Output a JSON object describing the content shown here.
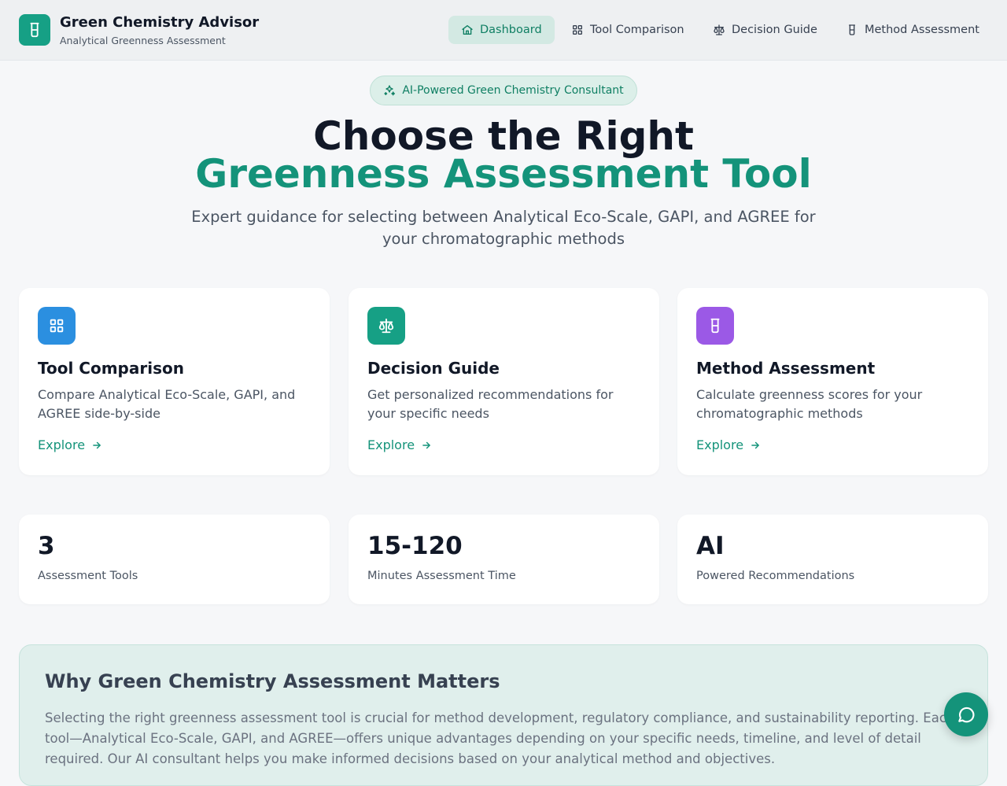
{
  "app": {
    "title": "Green Chemistry Advisor",
    "subtitle": "Analytical Greenness Assessment",
    "logo_icon": "beaker-icon",
    "accent": "#16a085"
  },
  "nav": {
    "items": [
      {
        "label": "Dashboard",
        "icon": "home-icon",
        "active": true
      },
      {
        "label": "Tool Comparison",
        "icon": "grid-icon",
        "active": false
      },
      {
        "label": "Decision Guide",
        "icon": "scale-icon",
        "active": false
      },
      {
        "label": "Method Assessment",
        "icon": "beaker-icon",
        "active": false
      }
    ]
  },
  "hero": {
    "badge": "AI-Powered Green Chemistry Consultant",
    "badge_icon": "sparkles-icon",
    "title_line1": "Choose the Right",
    "title_line2": "Greenness Assessment Tool",
    "subtitle": "Expert guidance for selecting between Analytical Eco-Scale, GAPI, and AGREE for your chromatographic methods"
  },
  "features": [
    {
      "title": "Tool Comparison",
      "description": "Compare Analytical Eco-Scale, GAPI, and AGREE side-by-side",
      "link": "Explore",
      "icon": "grid-icon",
      "color": "#2b8fe0"
    },
    {
      "title": "Decision Guide",
      "description": "Get personalized recommendations for your specific needs",
      "link": "Explore",
      "icon": "scale-icon",
      "color": "#16a085"
    },
    {
      "title": "Method Assessment",
      "description": "Calculate greenness scores for your chromatographic methods",
      "link": "Explore",
      "icon": "beaker-icon",
      "color": "#9b59e6"
    }
  ],
  "stats": [
    {
      "value": "3",
      "label": "Assessment Tools"
    },
    {
      "value": "15-120",
      "label": "Minutes Assessment Time"
    },
    {
      "value": "AI",
      "label": "Powered Recommendations"
    }
  ],
  "why": {
    "title": "Why Green Chemistry Assessment Matters",
    "body": "Selecting the right greenness assessment tool is crucial for method development, regulatory compliance, and sustainability reporting. Each tool—Analytical Eco-Scale, GAPI, and AGREE—offers unique advantages depending on your specific needs, timeline, and level of detail required. Our AI consultant helps you make informed decisions based on your analytical method and objectives."
  },
  "chat": {
    "icon": "chat-bubble-icon"
  }
}
